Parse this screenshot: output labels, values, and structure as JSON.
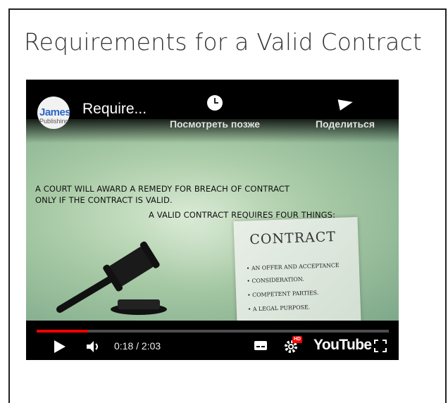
{
  "page": {
    "title": "Requirements for a Valid Contract"
  },
  "video": {
    "channel_logo_text": "James",
    "channel_logo_subtext": "Publishing",
    "title": "Require...",
    "watch_later_label": "Посмотреть позже",
    "share_label": "Поделиться",
    "slide": {
      "line1": "A COURT WILL AWARD A REMEDY FOR BREACH OF CONTRACT",
      "line2": "ONLY IF THE CONTRACT IS VALID.",
      "line3": "A VALID CONTRACT REQUIRES FOUR THINGS:",
      "document_title": "CONTRACT",
      "document_items": [
        "• AN OFFER AND ACCEPTANCE",
        "• CONSIDERATION.",
        "• COMPETENT PARTIES.",
        "• A LEGAL PURPOSE."
      ]
    },
    "controls": {
      "time": "0:18 / 2:03",
      "progress_fraction": 0.146,
      "hd_badge": "HD",
      "brand": "YouTube"
    },
    "icons": {
      "play": "play-icon",
      "volume": "volume-icon",
      "captions": "captions-icon",
      "settings": "gear-icon",
      "fullscreen": "fullscreen-icon",
      "watch_later": "clock-icon",
      "share": "share-arrow-icon"
    },
    "colors": {
      "progress": "#ff0000",
      "player_bg": "#000000",
      "slide_bg": "#a8caa5"
    }
  }
}
